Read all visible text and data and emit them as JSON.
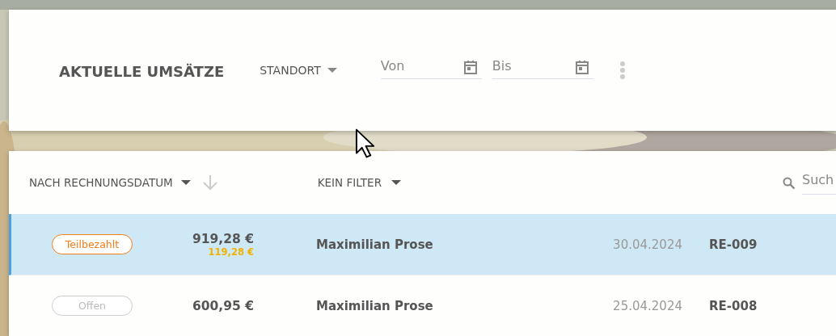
{
  "header": {
    "title": "AKTUELLE UMSÄTZE",
    "location_filter": "STANDORT",
    "from_field": {
      "placeholder": "Von"
    },
    "to_field": {
      "placeholder": "Bis"
    }
  },
  "toolbar": {
    "sort": "NACH RECHNUNGSDATUM",
    "filter": "KEIN FILTER",
    "search": {
      "placeholder": "Such"
    }
  },
  "rows": [
    {
      "selected": true,
      "status": "Teilbezahlt",
      "kind": "partial",
      "amount": "919,28 €",
      "open_amount": "119,28 €",
      "customer": "Maximilian Prose",
      "date": "30.04.2024",
      "invoice": "RE-009"
    },
    {
      "selected": false,
      "status": "Offen",
      "kind": "open",
      "amount": "600,95 €",
      "customer": "Maximilian Prose",
      "date": "25.04.2024",
      "invoice": "RE-008"
    }
  ]
}
